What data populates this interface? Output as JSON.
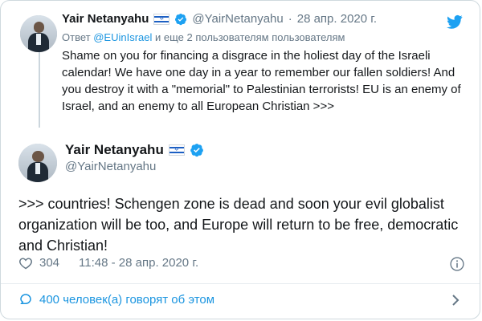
{
  "parent": {
    "name": "Yair Netanyahu",
    "handle": "@YairNetanyahu",
    "separator": "·",
    "date": "28 апр. 2020 г.",
    "reply_to_prefix": "Ответ",
    "reply_to_mention": "@EUinIsrael",
    "reply_to_suffix": "и еще 2 пользователям пользователям",
    "text": "Shame on you for financing a disgrace in the holiest day of the Israeli calendar! We have one day in a year to remember our fallen soldiers! And you destroy it with a \"memorial\" to Palestinian terrorists! EU is an enemy of Israel, and an enemy to all European Christian >>>"
  },
  "main": {
    "name": "Yair Netanyahu",
    "handle": "@YairNetanyahu",
    "text": ">>> countries! Schengen zone is dead and soon your evil globalist organization will be too, and Europe will return to be free, democratic and Christian!",
    "likes": "304",
    "timestamp": "11:48 - 28 апр. 2020 г."
  },
  "footer": {
    "talk_label": "400 человек(а) говорят об этом"
  },
  "colors": {
    "accent": "#1b95e0",
    "muted": "#657786",
    "text": "#14171a",
    "verified": "#1da1f2"
  },
  "icons": [
    "twitter-bird-icon",
    "verified-badge-icon",
    "israel-flag-icon",
    "heart-icon",
    "info-icon",
    "speech-bubble-icon",
    "chevron-right-icon"
  ]
}
